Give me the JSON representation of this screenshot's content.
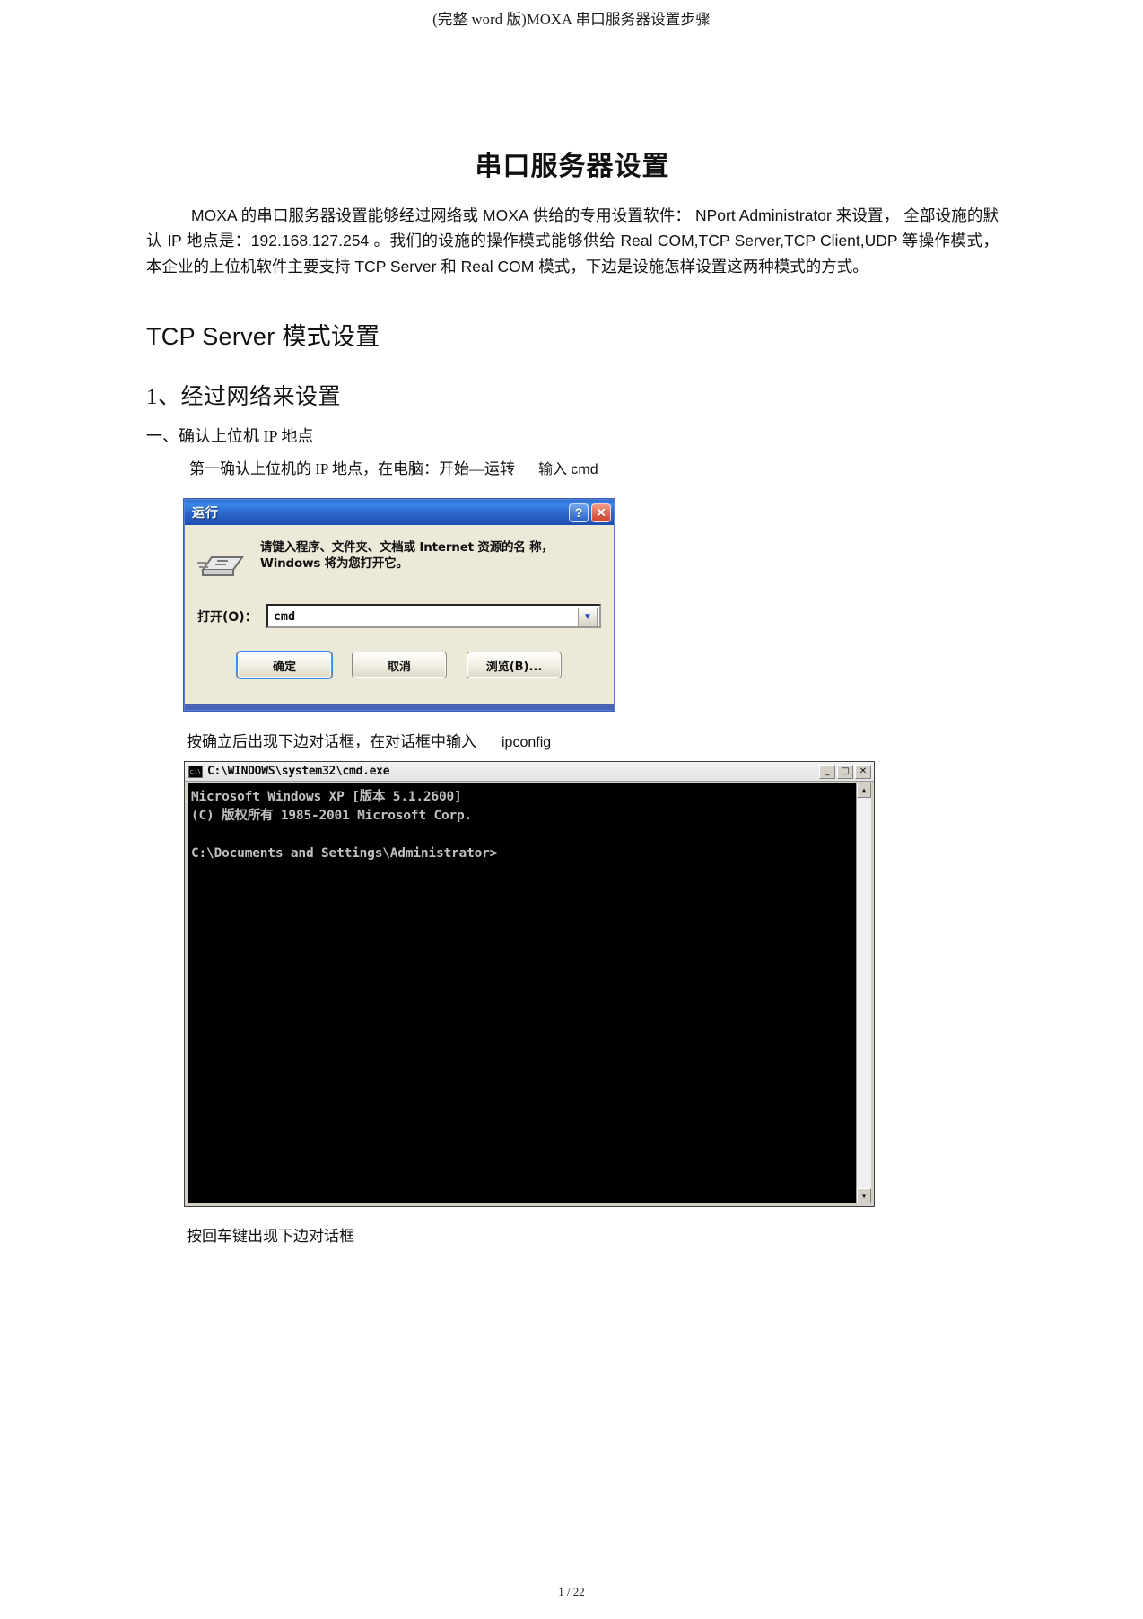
{
  "header": {
    "running_title": "(完整 word 版)MOXA 串口服务器设置步骤"
  },
  "document": {
    "title": "串口服务器设置",
    "paragraph_1": {
      "seg_1": "MOXA",
      "seg_2": "的串口服务器设置能够经过网络或",
      "seg_3": "MOXA",
      "seg_4": "供给的专用设置软件：",
      "seg_5": "NPort Administrator 来设置，",
      "seg_6": "全部设施的默认 IP 地点是：",
      "seg_7": "192.168.127.254",
      "seg_8": "。我们的设施的操作模式能够供给 Real COM,TCP Server,TCP Client,UDP 等操作模式，",
      "seg_9": "本企业的上位机软件主要支持 TCP Server 和 Real COM 模式，下边是设施怎样设置这两种模式的方式。",
      "full": "MOXA 的串口服务器设置能够经过网络或 MOXA 供给的专用设置软件： NPort Administrator 来设置， 全部设施的默认 IP 地点是：192.168.127.254 。我们的设施的操作模式能够供给 Real COM,TCP Server,TCP Client,UDP 等操作模式， 本企业的上位机软件主要支持 TCP Server 和 Real COM 模式，下边是设施怎样设置这两种模式的方式。"
    },
    "heading_1": "TCP Server 模式设置",
    "heading_2": "1、经过网络来设置",
    "list_item_1": "一、确认上位机   IP 地点",
    "sub_text_1": "第一确认上位机的   IP 地点，在电脑：开始—运转",
    "sub_text_1_cmd": "输入  cmd",
    "caption_run": "按确立后出现下边对话框，在对话框中输入",
    "caption_run_cmd": "ipconfig",
    "caption_cmd": "按回车键出现下边对话框",
    "footer": "1 / 22"
  },
  "run_dialog": {
    "title": "运行",
    "help_button": "?",
    "close_button": "✕",
    "message": "请键入程序、文件夹、文档或 Internet 资源的名\n称，Windows 将为您打开它。",
    "open_label": "打开(O)：",
    "open_value": "cmd",
    "combo_arrow": "▼",
    "buttons": {
      "ok": "确定",
      "cancel": "取消",
      "browse": "浏览(B)..."
    }
  },
  "cmd_window": {
    "title": "C:\\WINDOWS\\system32\\cmd.exe",
    "icon_label": "c:\\",
    "minimize": "_",
    "maximize": "□",
    "close": "✕",
    "scroll_up": "▲",
    "scroll_down": "▼",
    "lines": [
      "Microsoft Windows XP [版本 5.1.2600]",
      "(C) 版权所有 1985-2001 Microsoft Corp.",
      "",
      "C:\\Documents and Settings\\Administrator>"
    ]
  },
  "colors": {
    "xp_title_blue": "#2f6fd4",
    "xp_face": "#ece9d8",
    "console_bg": "#000000",
    "console_fg": "#c0c0c0"
  }
}
